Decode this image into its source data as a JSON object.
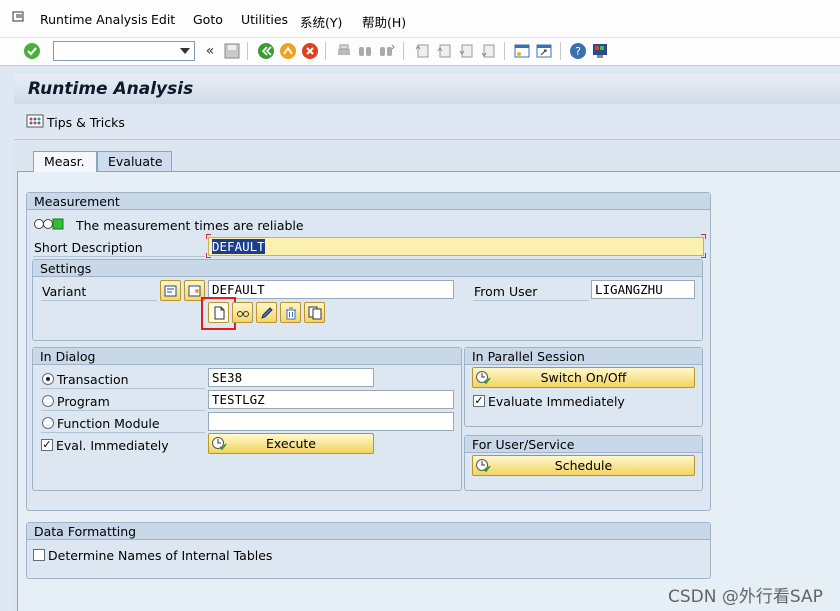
{
  "menu": {
    "items": [
      "Runtime Analysis",
      "Edit",
      "Goto",
      "Utilities",
      "系统(Y)",
      "帮助(H)"
    ]
  },
  "toolbar": {
    "command_value": "",
    "back_symbol": "«",
    "icons": [
      "enter-check-icon",
      "save-icon",
      "back-icon",
      "exit-icon",
      "cancel-icon",
      "print-icon",
      "find-icon",
      "find-next-icon",
      "first-page-icon",
      "prev-page-icon",
      "next-page-icon",
      "last-page-icon",
      "new-session-icon",
      "shortcut-icon",
      "help-icon",
      "customize-icon"
    ]
  },
  "page": {
    "title": "Runtime Analysis",
    "tips_label": "Tips & Tricks"
  },
  "tabs": [
    "Measr.",
    "Evaluate"
  ],
  "measurement": {
    "title": "Measurement",
    "reliability_text": "The measurement times are reliable",
    "short_desc_label": "Short Description",
    "short_desc_value": "DEFAULT"
  },
  "settings": {
    "title": "Settings",
    "variant_label": "Variant",
    "variant_value": "DEFAULT",
    "from_user_label": "From User",
    "from_user_value": "LIGANGZHU"
  },
  "in_dialog": {
    "title": "In Dialog",
    "transaction_label": "Transaction",
    "transaction_value": "SE38",
    "program_label": "Program",
    "program_value": "TESTLGZ",
    "function_label": "Function Module",
    "function_value": "",
    "eval_label": "Eval. Immediately",
    "execute_label": "Execute"
  },
  "parallel": {
    "title": "In Parallel Session",
    "switch_label": "Switch On/Off",
    "evaluate_label": "Evaluate Immediately"
  },
  "user_service": {
    "title": "For User/Service",
    "schedule_label": "Schedule"
  },
  "data_formatting": {
    "title": "Data Formatting",
    "determine_label": "Determine Names of Internal Tables"
  },
  "watermark": "CSDN @外行看SAP"
}
